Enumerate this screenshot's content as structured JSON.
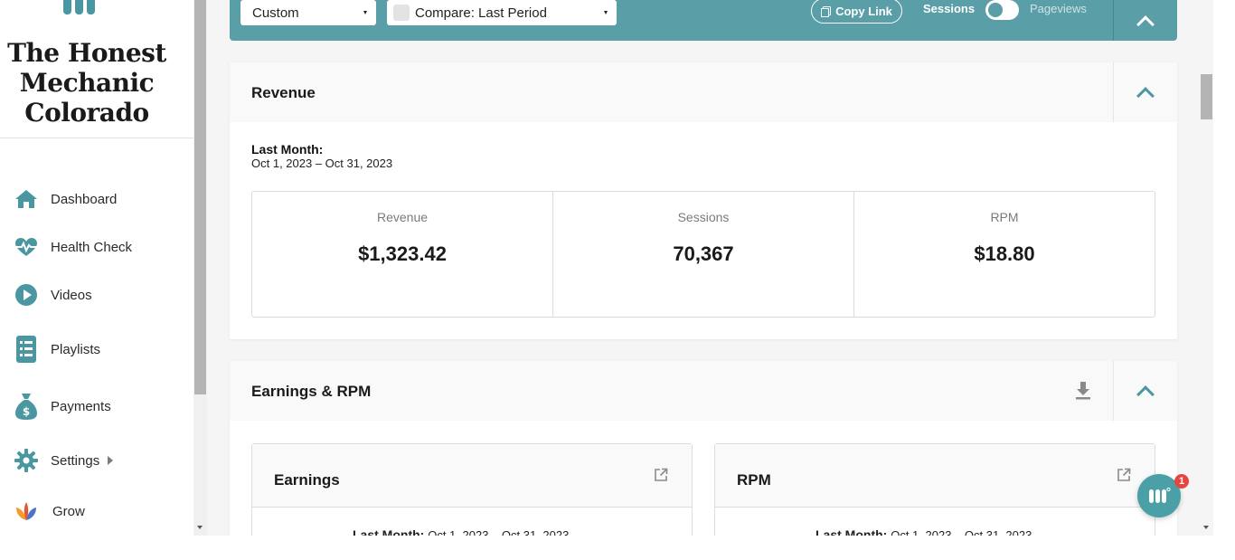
{
  "sidebar": {
    "site_title_line1": "The Honest",
    "site_title_line2": "Mechanic",
    "site_title_line3": "Colorado",
    "items": [
      {
        "label": "Dashboard",
        "icon": "home-icon"
      },
      {
        "label": "Health Check",
        "icon": "heartbeat-icon"
      },
      {
        "label": "Videos",
        "icon": "play-icon"
      },
      {
        "label": "Playlists",
        "icon": "list-icon"
      },
      {
        "label": "Payments",
        "icon": "money-bag-icon"
      },
      {
        "label": "Settings",
        "icon": "gear-icon"
      },
      {
        "label": "Grow",
        "icon": "grow-logo-icon"
      }
    ]
  },
  "filter_bar": {
    "range_value": "Custom",
    "compare_value": "Compare: Last Period",
    "copy_link_label": "Copy Link",
    "sessions_label": "Sessions",
    "pageviews_label": "Pageviews"
  },
  "revenue": {
    "title": "Revenue",
    "period_label": "Last Month:",
    "period_range": "Oct 1, 2023 – Oct 31, 2023",
    "stats": [
      {
        "label": "Revenue",
        "value": "$1,323.42"
      },
      {
        "label": "Sessions",
        "value": "70,367"
      },
      {
        "label": "RPM",
        "value": "$18.80"
      }
    ]
  },
  "earnings_rpm": {
    "title": "Earnings & RPM",
    "earnings": {
      "title": "Earnings",
      "period_label": "Last Month:",
      "period_range": "Oct 1, 2023 – Oct 31, 2023"
    },
    "rpm": {
      "title": "RPM",
      "period_label": "Last Month:",
      "period_range": "Oct 1, 2023 – Oct 31, 2023"
    }
  },
  "chat": {
    "badge_count": "1"
  },
  "colors": {
    "accent": "#5a9ea8",
    "icon": "#4a97a1",
    "badge": "#e5463f"
  }
}
